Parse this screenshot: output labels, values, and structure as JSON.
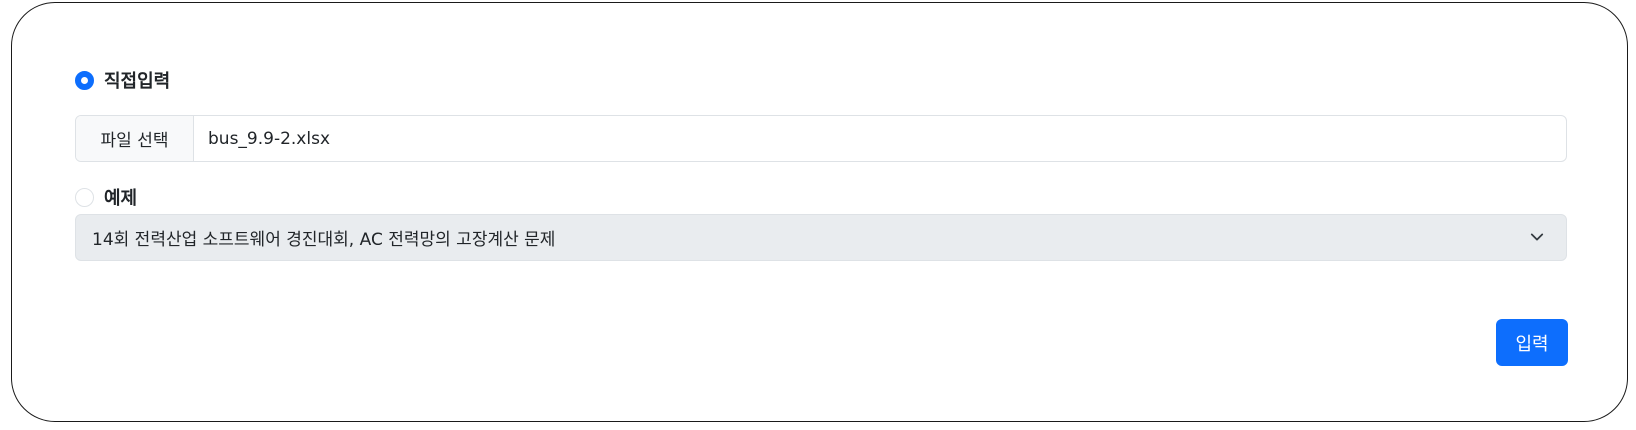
{
  "input_mode": {
    "direct": {
      "label": "직접입력",
      "checked": true
    },
    "example": {
      "label": "예제",
      "checked": false
    }
  },
  "file_input": {
    "button_label": "파일 선택",
    "file_name": "bus_9.9-2.xlsx"
  },
  "example_select": {
    "selected": "14회 전력산업 소프트웨어 경진대회, AC 전력망의 고장계산 문제",
    "icon": "chevron-down-icon"
  },
  "submit": {
    "label": "입력"
  },
  "colors": {
    "accent": "#0d6efd",
    "select_bg": "#e9ecef",
    "border": "#dee2e6"
  }
}
